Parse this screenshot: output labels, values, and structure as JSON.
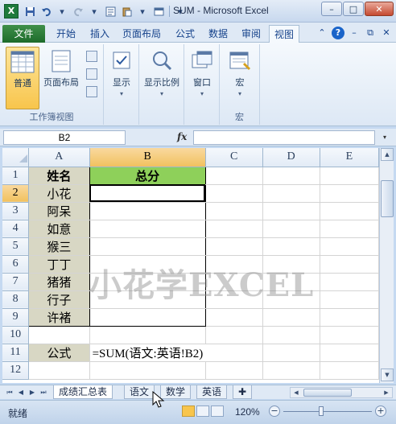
{
  "window": {
    "title": "SUM - Microsoft Excel",
    "logo": "X",
    "controls": {
      "minimize": "–",
      "restore": "□",
      "close": "✕"
    }
  },
  "qat": [
    "save-icon",
    "undo-icon",
    "redo-icon",
    "form-icon",
    "paste-icon",
    "dropdown-icon"
  ],
  "tabs": {
    "file": "文件",
    "items": [
      "开始",
      "插入",
      "页面布局",
      "公式",
      "数据",
      "审阅",
      "视图"
    ],
    "active": "视图"
  },
  "ribbon": {
    "groups": [
      {
        "label": "工作簿视图",
        "buttons": [
          {
            "label": "普通",
            "selected": true
          },
          {
            "label": "页面布局",
            "selected": false
          }
        ]
      },
      {
        "label": "",
        "buttons": [
          {
            "label": "显示",
            "arrow": "▾"
          }
        ]
      },
      {
        "label": "",
        "buttons": [
          {
            "label": "显示比例",
            "arrow": "▾"
          }
        ]
      },
      {
        "label": "",
        "buttons": [
          {
            "label": "窗口",
            "arrow": "▾"
          }
        ]
      },
      {
        "label": "宏",
        "buttons": [
          {
            "label": "宏",
            "arrow": "▾"
          }
        ]
      }
    ]
  },
  "formula_bar": {
    "name_box": "B2",
    "fx": "fx",
    "value": ""
  },
  "grid": {
    "columns": [
      "A",
      "B",
      "C",
      "D",
      "E"
    ],
    "selected_column": "B",
    "rows": [
      {
        "n": "1",
        "a": "姓名",
        "b": "总分"
      },
      {
        "n": "2",
        "a": "小花",
        "b": ""
      },
      {
        "n": "3",
        "a": "阿呆",
        "b": ""
      },
      {
        "n": "4",
        "a": "如意",
        "b": ""
      },
      {
        "n": "5",
        "a": "猴三",
        "b": ""
      },
      {
        "n": "6",
        "a": "丁丁",
        "b": ""
      },
      {
        "n": "7",
        "a": "猪猪",
        "b": ""
      },
      {
        "n": "8",
        "a": "行子",
        "b": ""
      },
      {
        "n": "9",
        "a": "许褚",
        "b": ""
      },
      {
        "n": "10",
        "a": "",
        "b": ""
      },
      {
        "n": "11",
        "a": "公式",
        "b": "=SUM(语文:英语!B2)"
      },
      {
        "n": "12",
        "a": "",
        "b": ""
      }
    ],
    "selected_row": "2",
    "watermark": "小花学EXCEL"
  },
  "sheets": {
    "tabs": [
      "成绩汇总表",
      "语文",
      "数学",
      "英语"
    ],
    "active": "成绩汇总表"
  },
  "status": {
    "text": "就绪",
    "zoom": "120%",
    "zoom_minus": "−",
    "zoom_plus": "+"
  },
  "colors": {
    "header_fill": "#8ed05a",
    "name_fill": "#d8d7c4",
    "file_tab": "#1d6c2b",
    "selected": "#f8c54c"
  }
}
